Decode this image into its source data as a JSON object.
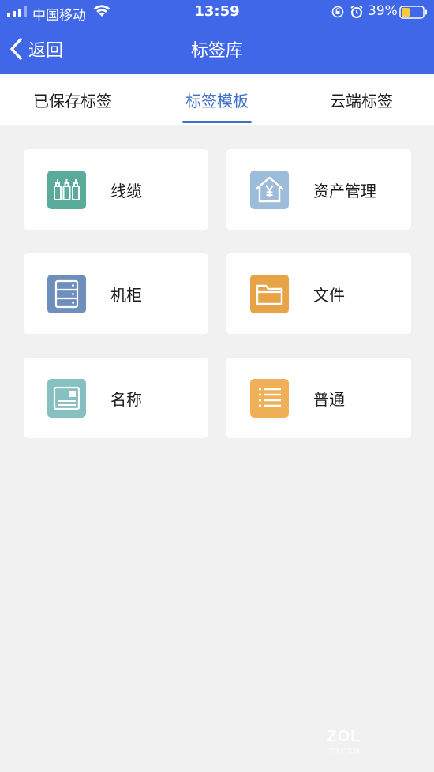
{
  "status_bar": {
    "carrier": "中国移动",
    "time": "13:59",
    "battery_percent": "39%",
    "battery_level": 0.39,
    "icons": [
      "signal-icon",
      "wifi-icon",
      "rotation-lock-icon",
      "alarm-icon",
      "battery-icon"
    ]
  },
  "nav": {
    "back_label": "返回",
    "title": "标签库",
    "background": "#3f67e8"
  },
  "tabs": [
    {
      "label": "已保存标签",
      "active": false
    },
    {
      "label": "标签模板",
      "active": true
    },
    {
      "label": "云端标签",
      "active": false
    }
  ],
  "accent_color": "#3e70c9",
  "templates": [
    {
      "label": "线缆",
      "icon": "cable-icon",
      "color": "#5aab9b"
    },
    {
      "label": "资产管理",
      "icon": "asset-house-icon",
      "color": "#9dbcd9"
    },
    {
      "label": "机柜",
      "icon": "cabinet-icon",
      "color": "#6e8fbb"
    },
    {
      "label": "文件",
      "icon": "folder-icon",
      "color": "#e8a346"
    },
    {
      "label": "名称",
      "icon": "name-card-icon",
      "color": "#86c0c0"
    },
    {
      "label": "普通",
      "icon": "list-icon",
      "color": "#f0b057"
    }
  ],
  "watermark": {
    "logo": "ZOL",
    "subtitle": "中关村在线"
  }
}
